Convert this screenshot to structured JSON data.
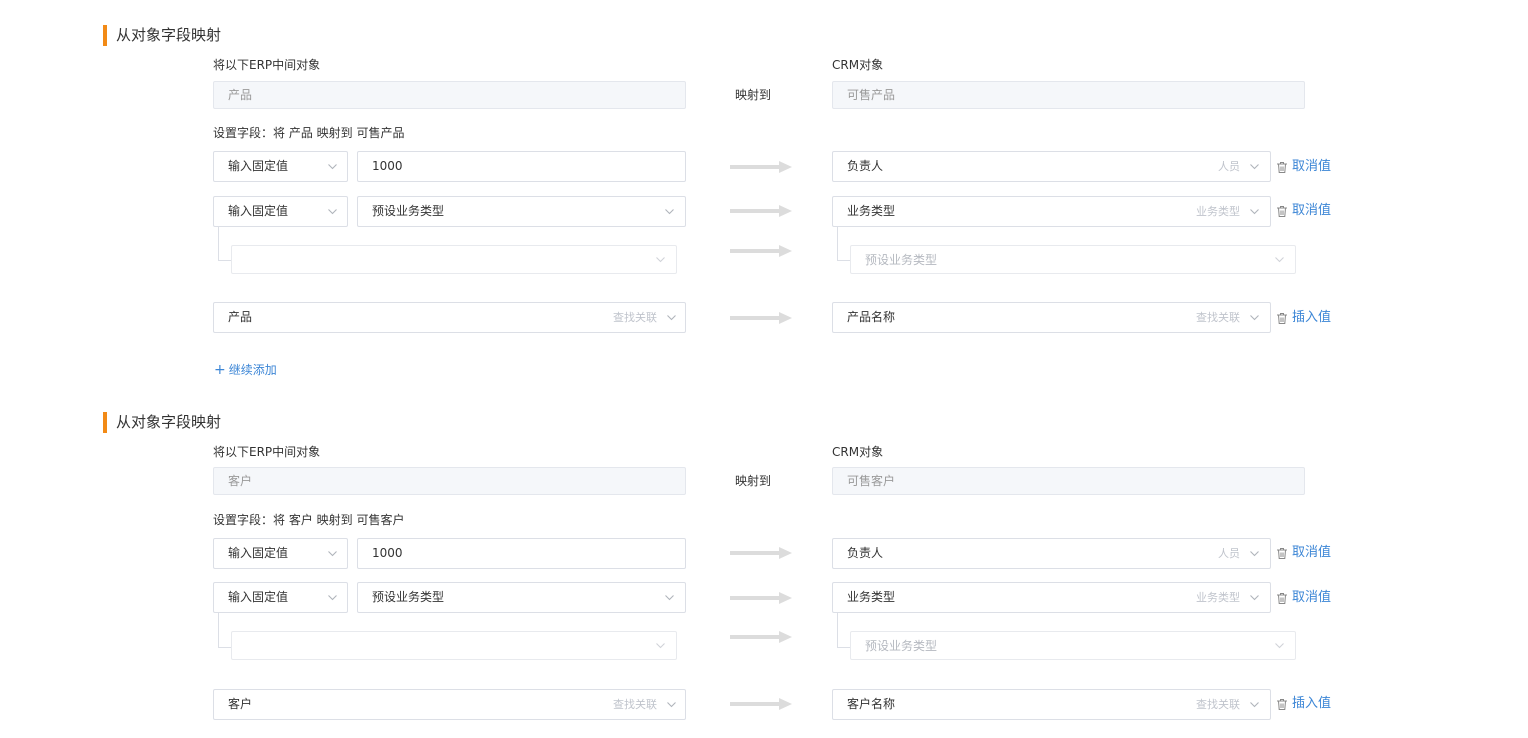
{
  "sections": [
    {
      "title": "从对象字段映射",
      "erp_label": "将以下ERP中间对象",
      "crm_label": "CRM对象",
      "erp_object": "产品",
      "maps_to": "映射到",
      "crm_object": "可售产品",
      "config_text": "设置字段：将 产品 映射到 可售产品",
      "rows": {
        "r1": {
          "mode": "输入固定值",
          "value": "1000",
          "target": "负责人",
          "target_type": "人员",
          "action": "取消值"
        },
        "r2": {
          "mode": "输入固定值",
          "value": "预设业务类型",
          "target": "业务类型",
          "target_type": "业务类型",
          "action": "取消值"
        },
        "r2sub": {
          "source_value": "",
          "target_placeholder": "预设业务类型"
        },
        "r3": {
          "source": "产品",
          "source_type": "查找关联",
          "target": "产品名称",
          "target_type": "查找关联",
          "action": "插入值"
        }
      },
      "add_more": "继续添加"
    },
    {
      "title": "从对象字段映射",
      "erp_label": "将以下ERP中间对象",
      "crm_label": "CRM对象",
      "erp_object": "客户",
      "maps_to": "映射到",
      "crm_object": "可售客户",
      "config_text": "设置字段：将 客户 映射到 可售客户",
      "rows": {
        "r1": {
          "mode": "输入固定值",
          "value": "1000",
          "target": "负责人",
          "target_type": "人员",
          "action": "取消值"
        },
        "r2": {
          "mode": "输入固定值",
          "value": "预设业务类型",
          "target": "业务类型",
          "target_type": "业务类型",
          "action": "取消值"
        },
        "r2sub": {
          "source_value": "",
          "target_placeholder": "预设业务类型"
        },
        "r3": {
          "source": "客户",
          "source_type": "查找关联",
          "target": "客户名称",
          "target_type": "查找关联",
          "action": "插入值"
        }
      }
    }
  ],
  "colors": {
    "accent_bar": "#f28a16",
    "link": "#3c86d6",
    "arrow": "#dcdcdc"
  },
  "icons": {
    "dropdown": "chevron-down-icon",
    "delete": "trash-icon",
    "mapping": "arrow-right-icon",
    "add": "plus-icon"
  }
}
